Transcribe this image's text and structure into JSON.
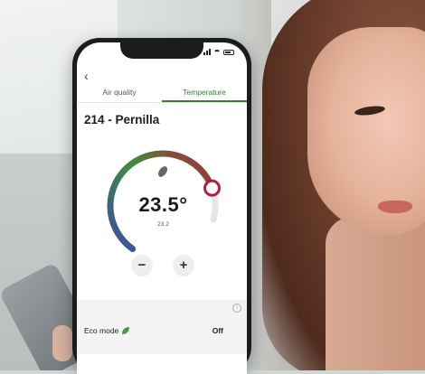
{
  "tabs": [
    {
      "label": "Air quality",
      "active": false
    },
    {
      "label": "Temperature",
      "active": true
    }
  ],
  "room": {
    "title": "214 - Pernilla"
  },
  "thermostat": {
    "setpoint": "23.5°",
    "current": "23.2",
    "setpoint_fraction": 0.86
  },
  "controls": {
    "minus": "−",
    "plus": "+"
  },
  "eco": {
    "label": "Eco mode",
    "value": "Off"
  },
  "colors": {
    "accent": "#3c7a3a",
    "arc_blue": "#3b4aa8",
    "arc_green": "#3f8f3d",
    "arc_red": "#b1203a",
    "arc_track": "#e6e6e6"
  }
}
